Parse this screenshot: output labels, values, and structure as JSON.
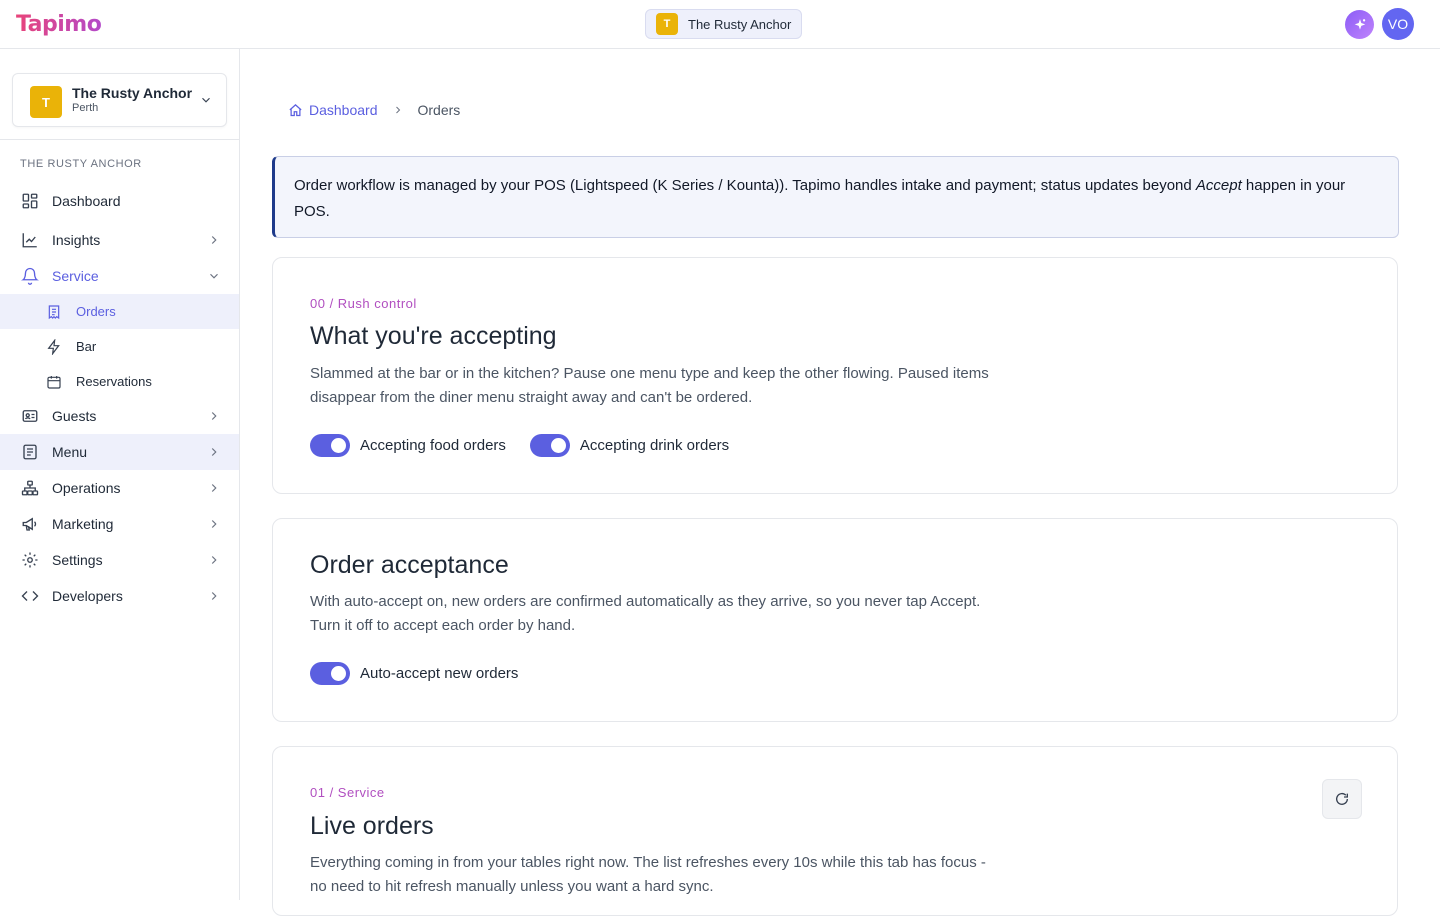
{
  "topbar": {
    "logo": "Tapimo",
    "venue_initial": "T",
    "venue_name": "The Rusty Anchor",
    "avatar_initials": "VO"
  },
  "sidebar": {
    "venue_initial": "T",
    "venue_name": "The Rusty Anchor",
    "venue_location": "Perth",
    "heading": "THE RUSTY ANCHOR",
    "items": [
      {
        "label": "Dashboard",
        "icon": "grid-icon"
      },
      {
        "label": "Insights",
        "icon": "chart-line-icon"
      },
      {
        "label": "Service",
        "icon": "bell-icon"
      },
      {
        "label": "Guests",
        "icon": "id-card-icon"
      },
      {
        "label": "Menu",
        "icon": "menu-book-icon"
      },
      {
        "label": "Operations",
        "icon": "org-chart-icon"
      },
      {
        "label": "Marketing",
        "icon": "megaphone-icon"
      },
      {
        "label": "Settings",
        "icon": "gear-icon"
      },
      {
        "label": "Developers",
        "icon": "code-icon"
      }
    ],
    "service_sub": [
      {
        "label": "Orders",
        "icon": "receipt-icon"
      },
      {
        "label": "Bar",
        "icon": "bolt-icon"
      },
      {
        "label": "Reservations",
        "icon": "calendar-icon"
      }
    ]
  },
  "breadcrumb": {
    "home": "Dashboard",
    "current": "Orders"
  },
  "notice": {
    "text_before": "Order workflow is managed by your POS (Lightspeed (K Series / Kounta)). Tapimo handles intake and payment; status updates beyond ",
    "emphasis": "Accept",
    "text_after": " happen in your POS."
  },
  "rush_card": {
    "kicker": "00 / Rush control",
    "title": "What you're accepting",
    "description": "Slammed at the bar or in the kitchen? Pause one menu type and keep the other flowing. Paused items disappear from the diner menu straight away and can't be ordered.",
    "toggle_food": "Accepting food orders",
    "toggle_drink": "Accepting drink orders"
  },
  "acceptance_card": {
    "title": "Order acceptance",
    "description": "With auto-accept on, new orders are confirmed automatically as they arrive, so you never tap Accept. Turn it off to accept each order by hand.",
    "toggle_auto": "Auto-accept new orders"
  },
  "live_card": {
    "kicker": "01 / Service",
    "title": "Live orders",
    "description": "Everything coming in from your tables right now. The list refreshes every 10s while this tab has focus - no need to hit refresh manually unless you want a hard sync."
  },
  "colors": {
    "accent": "#5b5fe0",
    "kicker": "#b14fc0",
    "venue_badge": "#eab308",
    "notice_border": "#1e3a8a"
  }
}
